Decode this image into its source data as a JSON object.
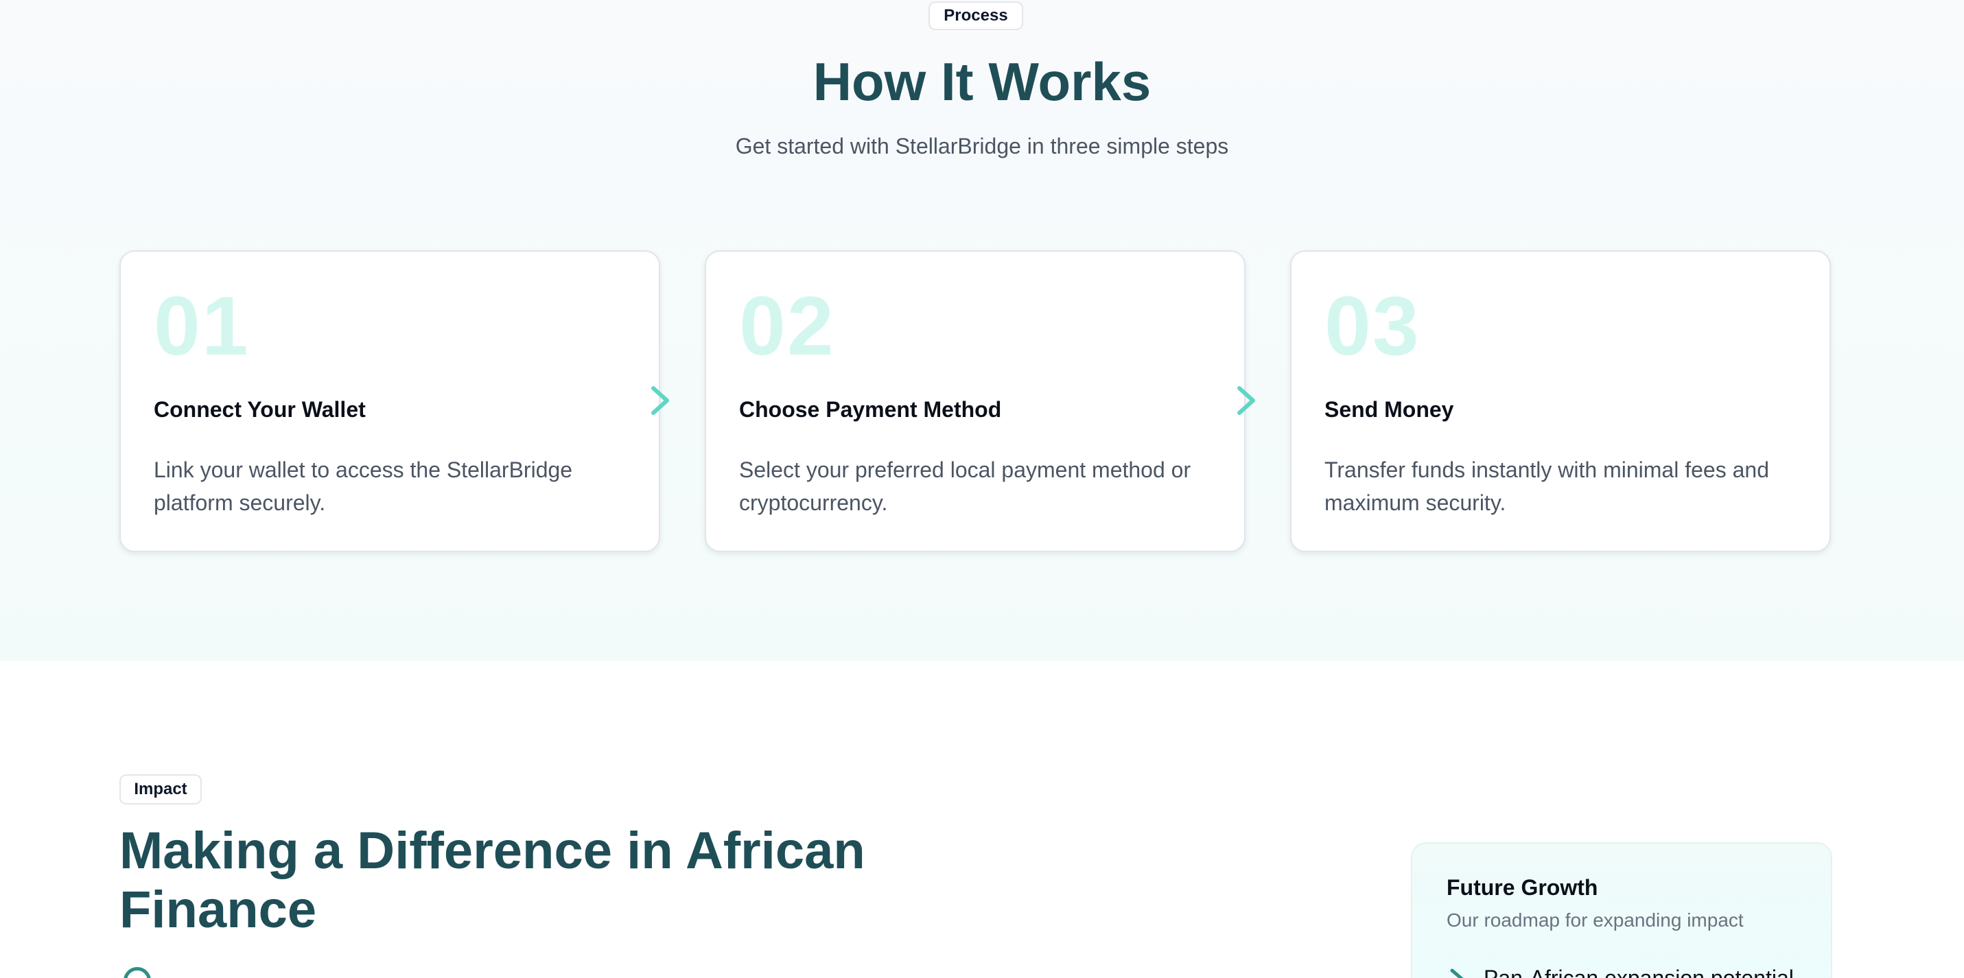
{
  "process": {
    "badge": "Process",
    "title": "How It Works",
    "subtitle": "Get started with StellarBridge in three simple steps",
    "steps": [
      {
        "number": "01",
        "title": "Connect Your Wallet",
        "description": "Link your wallet to access the StellarBridge platform securely."
      },
      {
        "number": "02",
        "title": "Choose Payment Method",
        "description": "Select your preferred local payment method or cryptocurrency."
      },
      {
        "number": "03",
        "title": "Send Money",
        "description": "Transfer funds instantly with minimal fees and maximum security."
      }
    ],
    "arrow_icon": "chevron-right-icon"
  },
  "impact": {
    "badge": "Impact",
    "title": "Making a Difference in African Finance",
    "growth_card": {
      "title": "Future Growth",
      "subtitle": "Our roadmap for expanding impact",
      "first_item": "Pan-African expansion potential"
    }
  },
  "colors": {
    "heading": "#1f4e57",
    "accent": "#5fd6c4",
    "step_number": "#d3f7ef",
    "body_text": "#4b5563"
  }
}
